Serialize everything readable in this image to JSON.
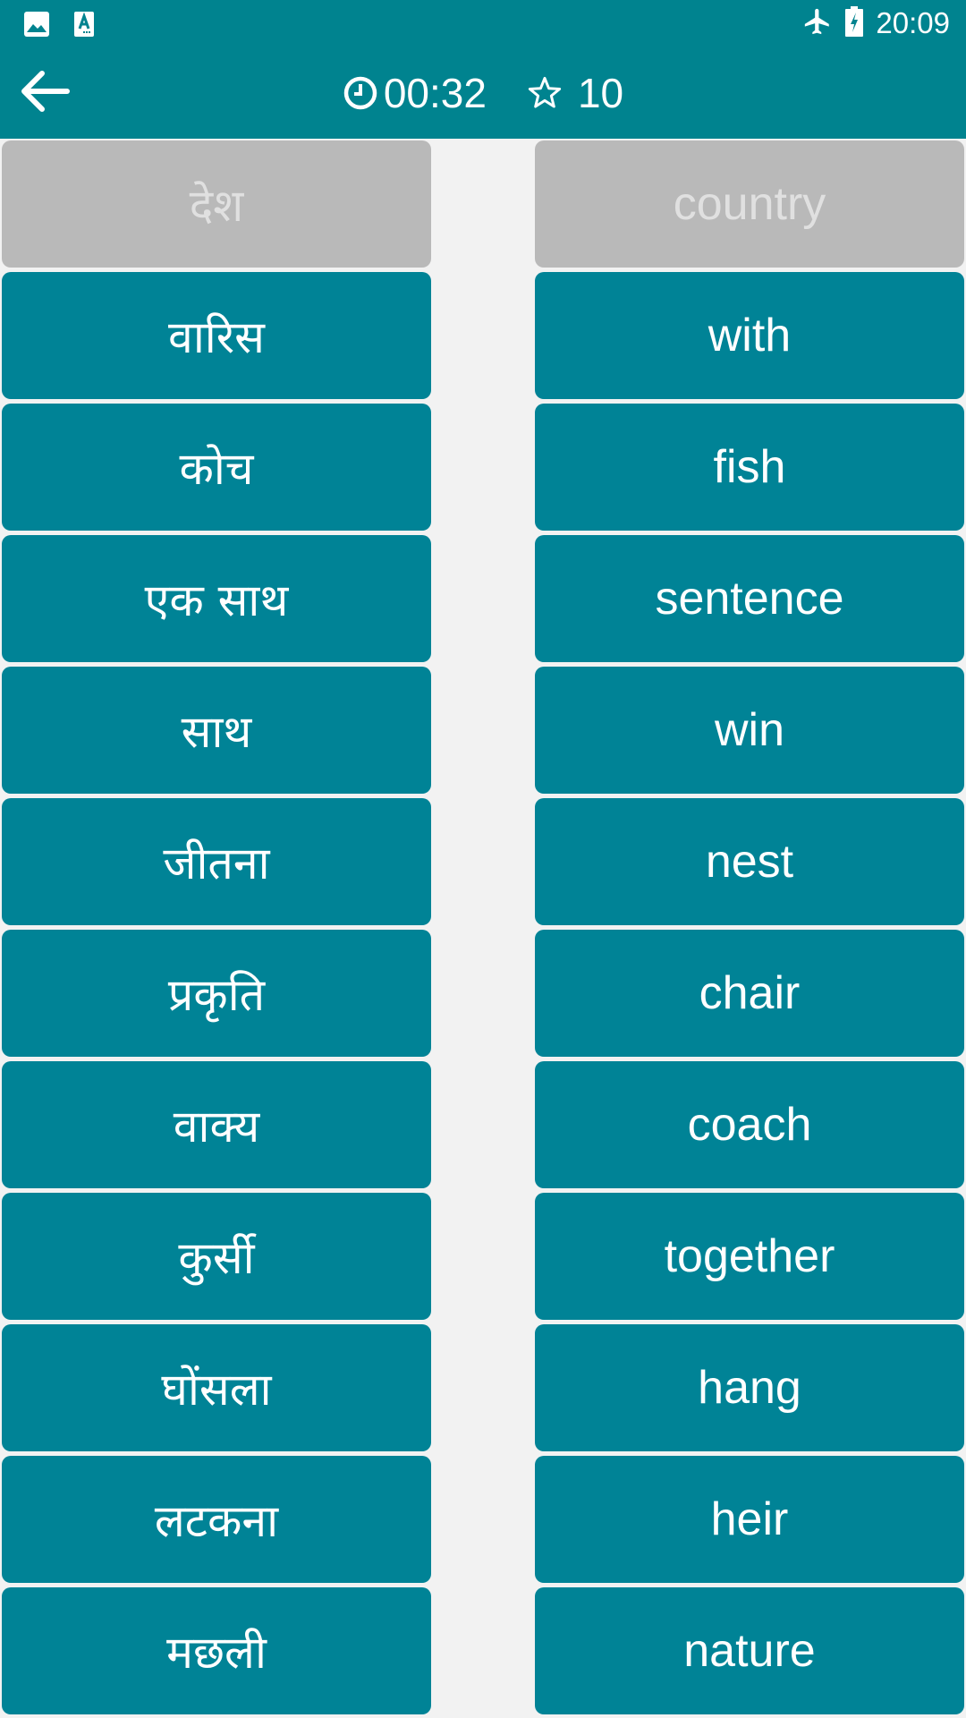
{
  "status_bar": {
    "left_icons": [
      "gallery-icon",
      "text-recognition-icon"
    ],
    "right_icons": [
      "airplane-mode-icon",
      "battery-charging-icon"
    ],
    "time": "20:09"
  },
  "toolbar": {
    "back_icon": "arrow-left-icon",
    "timer": {
      "icon": "clock-icon",
      "value": "00:32"
    },
    "score": {
      "icon": "star-outline-icon",
      "value": "10"
    }
  },
  "colors": {
    "primary": "#00838F",
    "card": "#008396",
    "card_disabled": "#B9B9B9",
    "card_disabled_text": "#E0E0E0",
    "background": "#F2F2F2",
    "text": "#FFFFFF"
  },
  "left_column": [
    {
      "text": "देश",
      "state": "matched"
    },
    {
      "text": "वारिस",
      "state": "active"
    },
    {
      "text": "कोच",
      "state": "active"
    },
    {
      "text": "एक साथ",
      "state": "active"
    },
    {
      "text": "साथ",
      "state": "active"
    },
    {
      "text": "जीतना",
      "state": "active"
    },
    {
      "text": "प्रकृति",
      "state": "active"
    },
    {
      "text": "वाक्य",
      "state": "active"
    },
    {
      "text": "कुर्सी",
      "state": "active"
    },
    {
      "text": "घोंसला",
      "state": "active"
    },
    {
      "text": "लटकना",
      "state": "active"
    },
    {
      "text": "मछली",
      "state": "active"
    }
  ],
  "right_column": [
    {
      "text": "country",
      "state": "matched"
    },
    {
      "text": "with",
      "state": "active"
    },
    {
      "text": "fish",
      "state": "active"
    },
    {
      "text": "sentence",
      "state": "active"
    },
    {
      "text": "win",
      "state": "active"
    },
    {
      "text": "nest",
      "state": "active"
    },
    {
      "text": "chair",
      "state": "active"
    },
    {
      "text": "coach",
      "state": "active"
    },
    {
      "text": "together",
      "state": "active"
    },
    {
      "text": "hang",
      "state": "active"
    },
    {
      "text": "heir",
      "state": "active"
    },
    {
      "text": "nature",
      "state": "active"
    }
  ]
}
